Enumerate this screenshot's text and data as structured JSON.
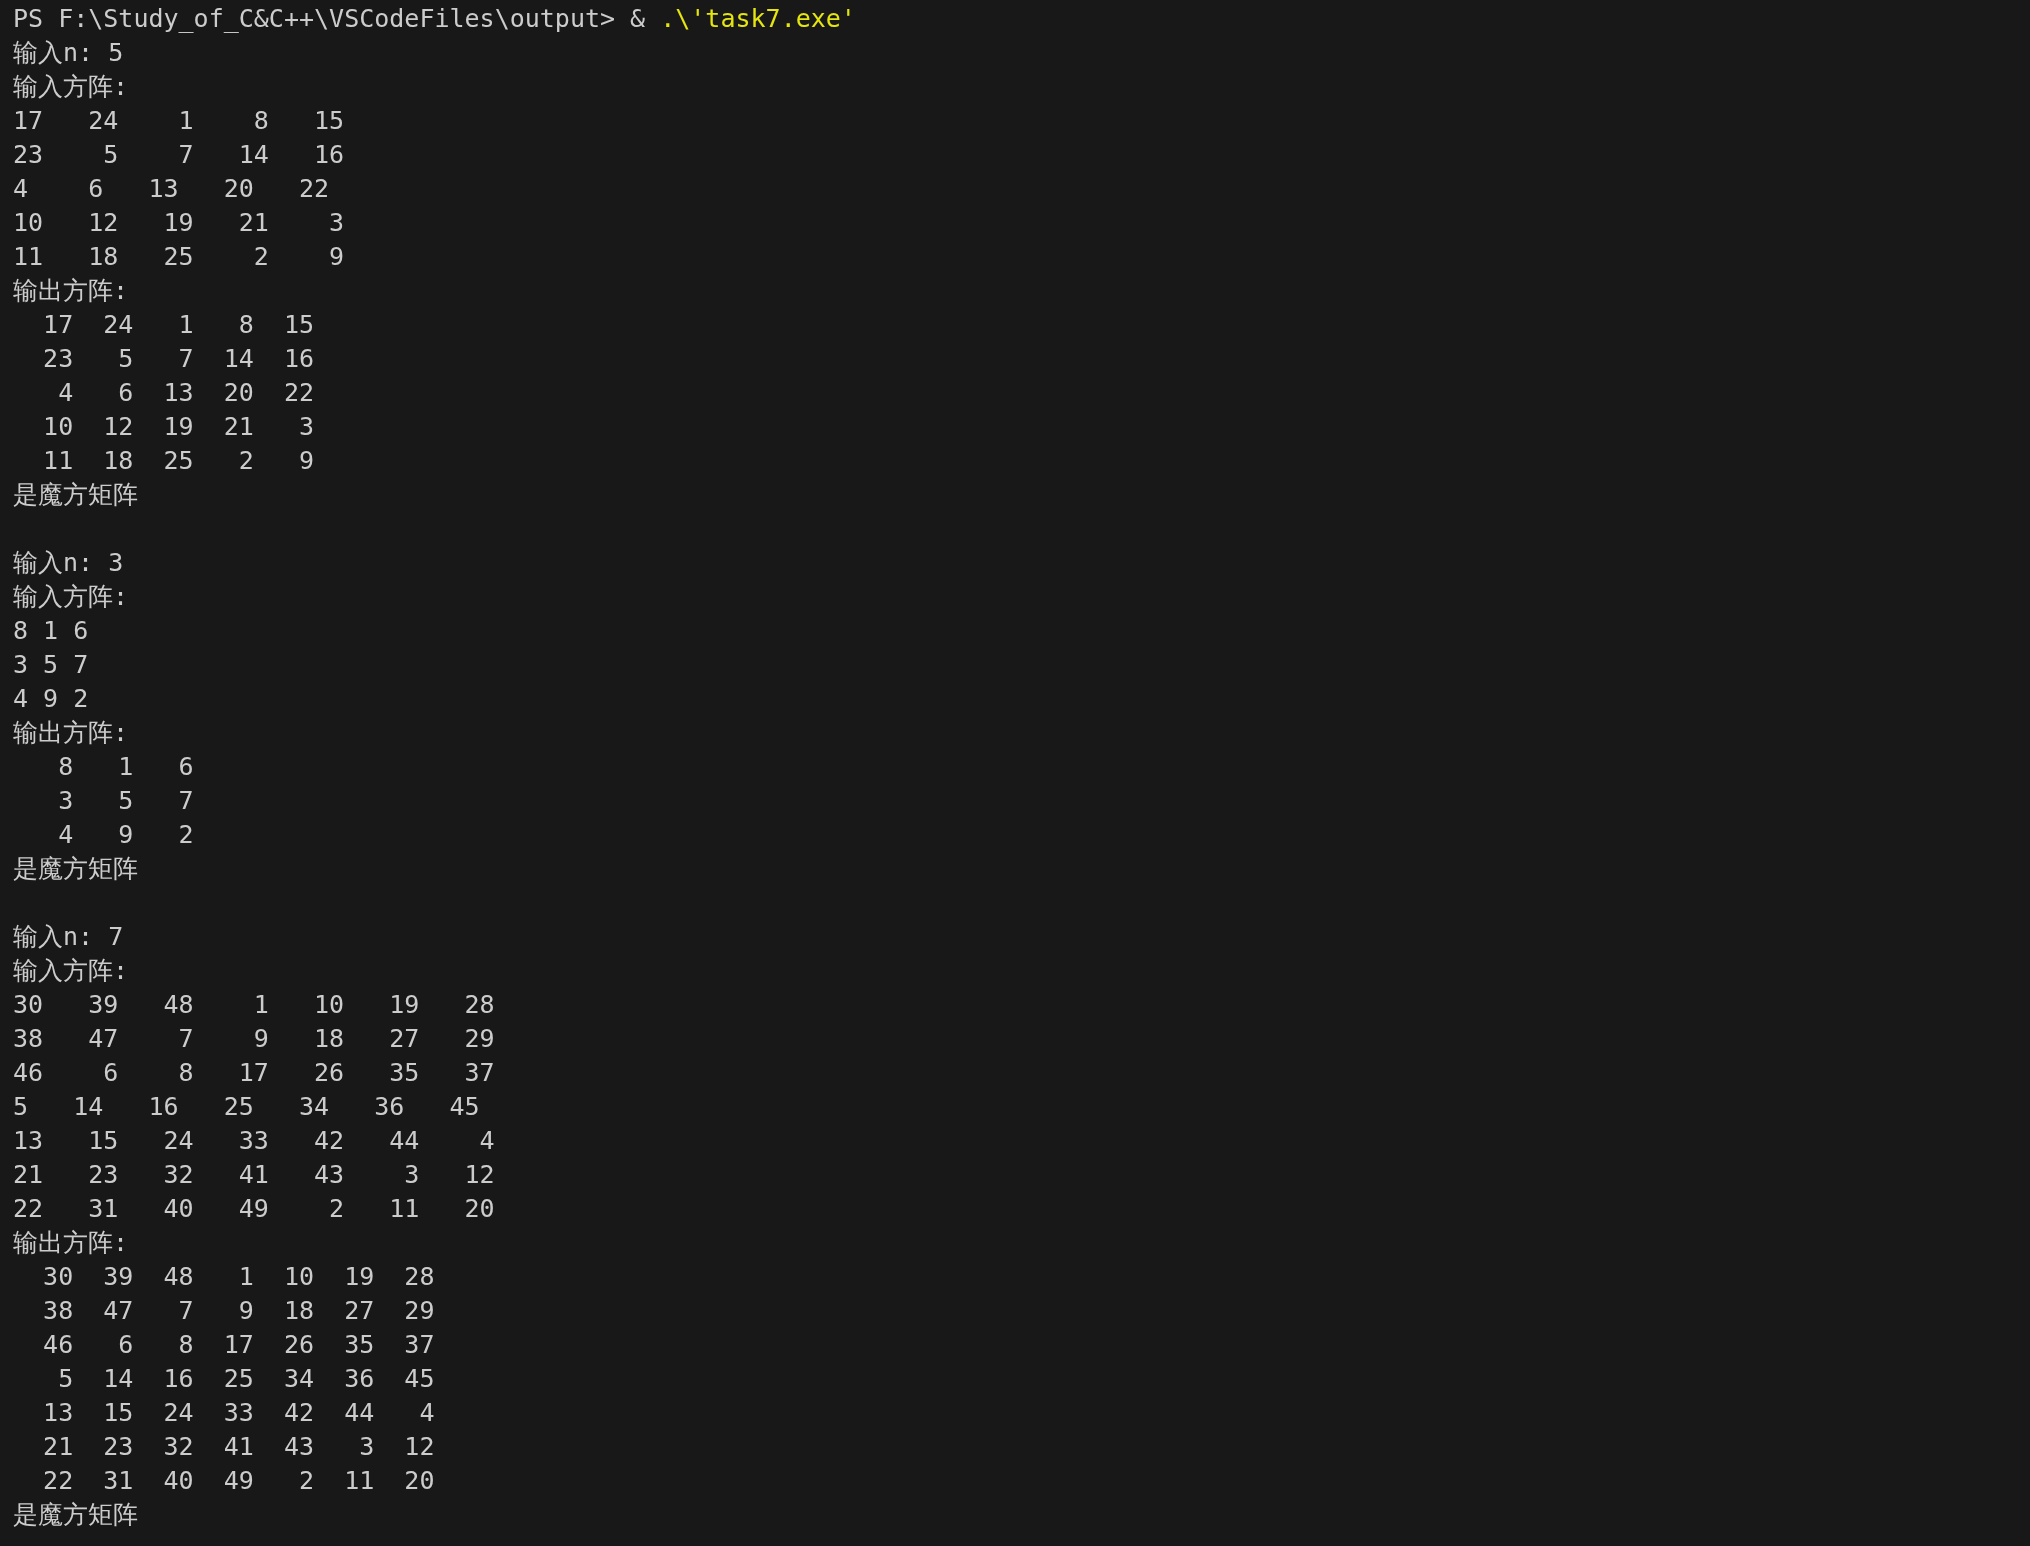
{
  "prompt": {
    "text": "PS F:\\Study_of_C&C++\\VSCodeFiles\\output> & ",
    "command": ".\\'task7.exe'"
  },
  "runs": [
    {
      "lines": [
        "输入n: 5",
        "输入方阵:",
        "17   24    1    8   15",
        "23    5    7   14   16",
        "4    6   13   20   22",
        "10   12   19   21    3",
        "11   18   25    2    9",
        "输出方阵:",
        "  17  24   1   8  15",
        "  23   5   7  14  16",
        "   4   6  13  20  22",
        "  10  12  19  21   3",
        "  11  18  25   2   9",
        "是魔方矩阵"
      ]
    },
    {
      "lines": [
        "输入n: 3",
        "输入方阵:",
        "8 1 6",
        "3 5 7",
        "4 9 2",
        "输出方阵:",
        "   8   1   6",
        "   3   5   7",
        "   4   9   2",
        "是魔方矩阵"
      ]
    },
    {
      "lines": [
        "输入n: 7",
        "输入方阵:",
        "30   39   48    1   10   19   28",
        "38   47    7    9   18   27   29",
        "46    6    8   17   26   35   37",
        "5   14   16   25   34   36   45",
        "13   15   24   33   42   44    4",
        "21   23   32   41   43    3   12",
        "22   31   40   49    2   11   20",
        "输出方阵:",
        "  30  39  48   1  10  19  28",
        "  38  47   7   9  18  27  29",
        "  46   6   8  17  26  35  37",
        "   5  14  16  25  34  36  45",
        "  13  15  24  33  42  44   4",
        "  21  23  32  41  43   3  12",
        "  22  31  40  49   2  11  20",
        "是魔方矩阵"
      ]
    }
  ]
}
